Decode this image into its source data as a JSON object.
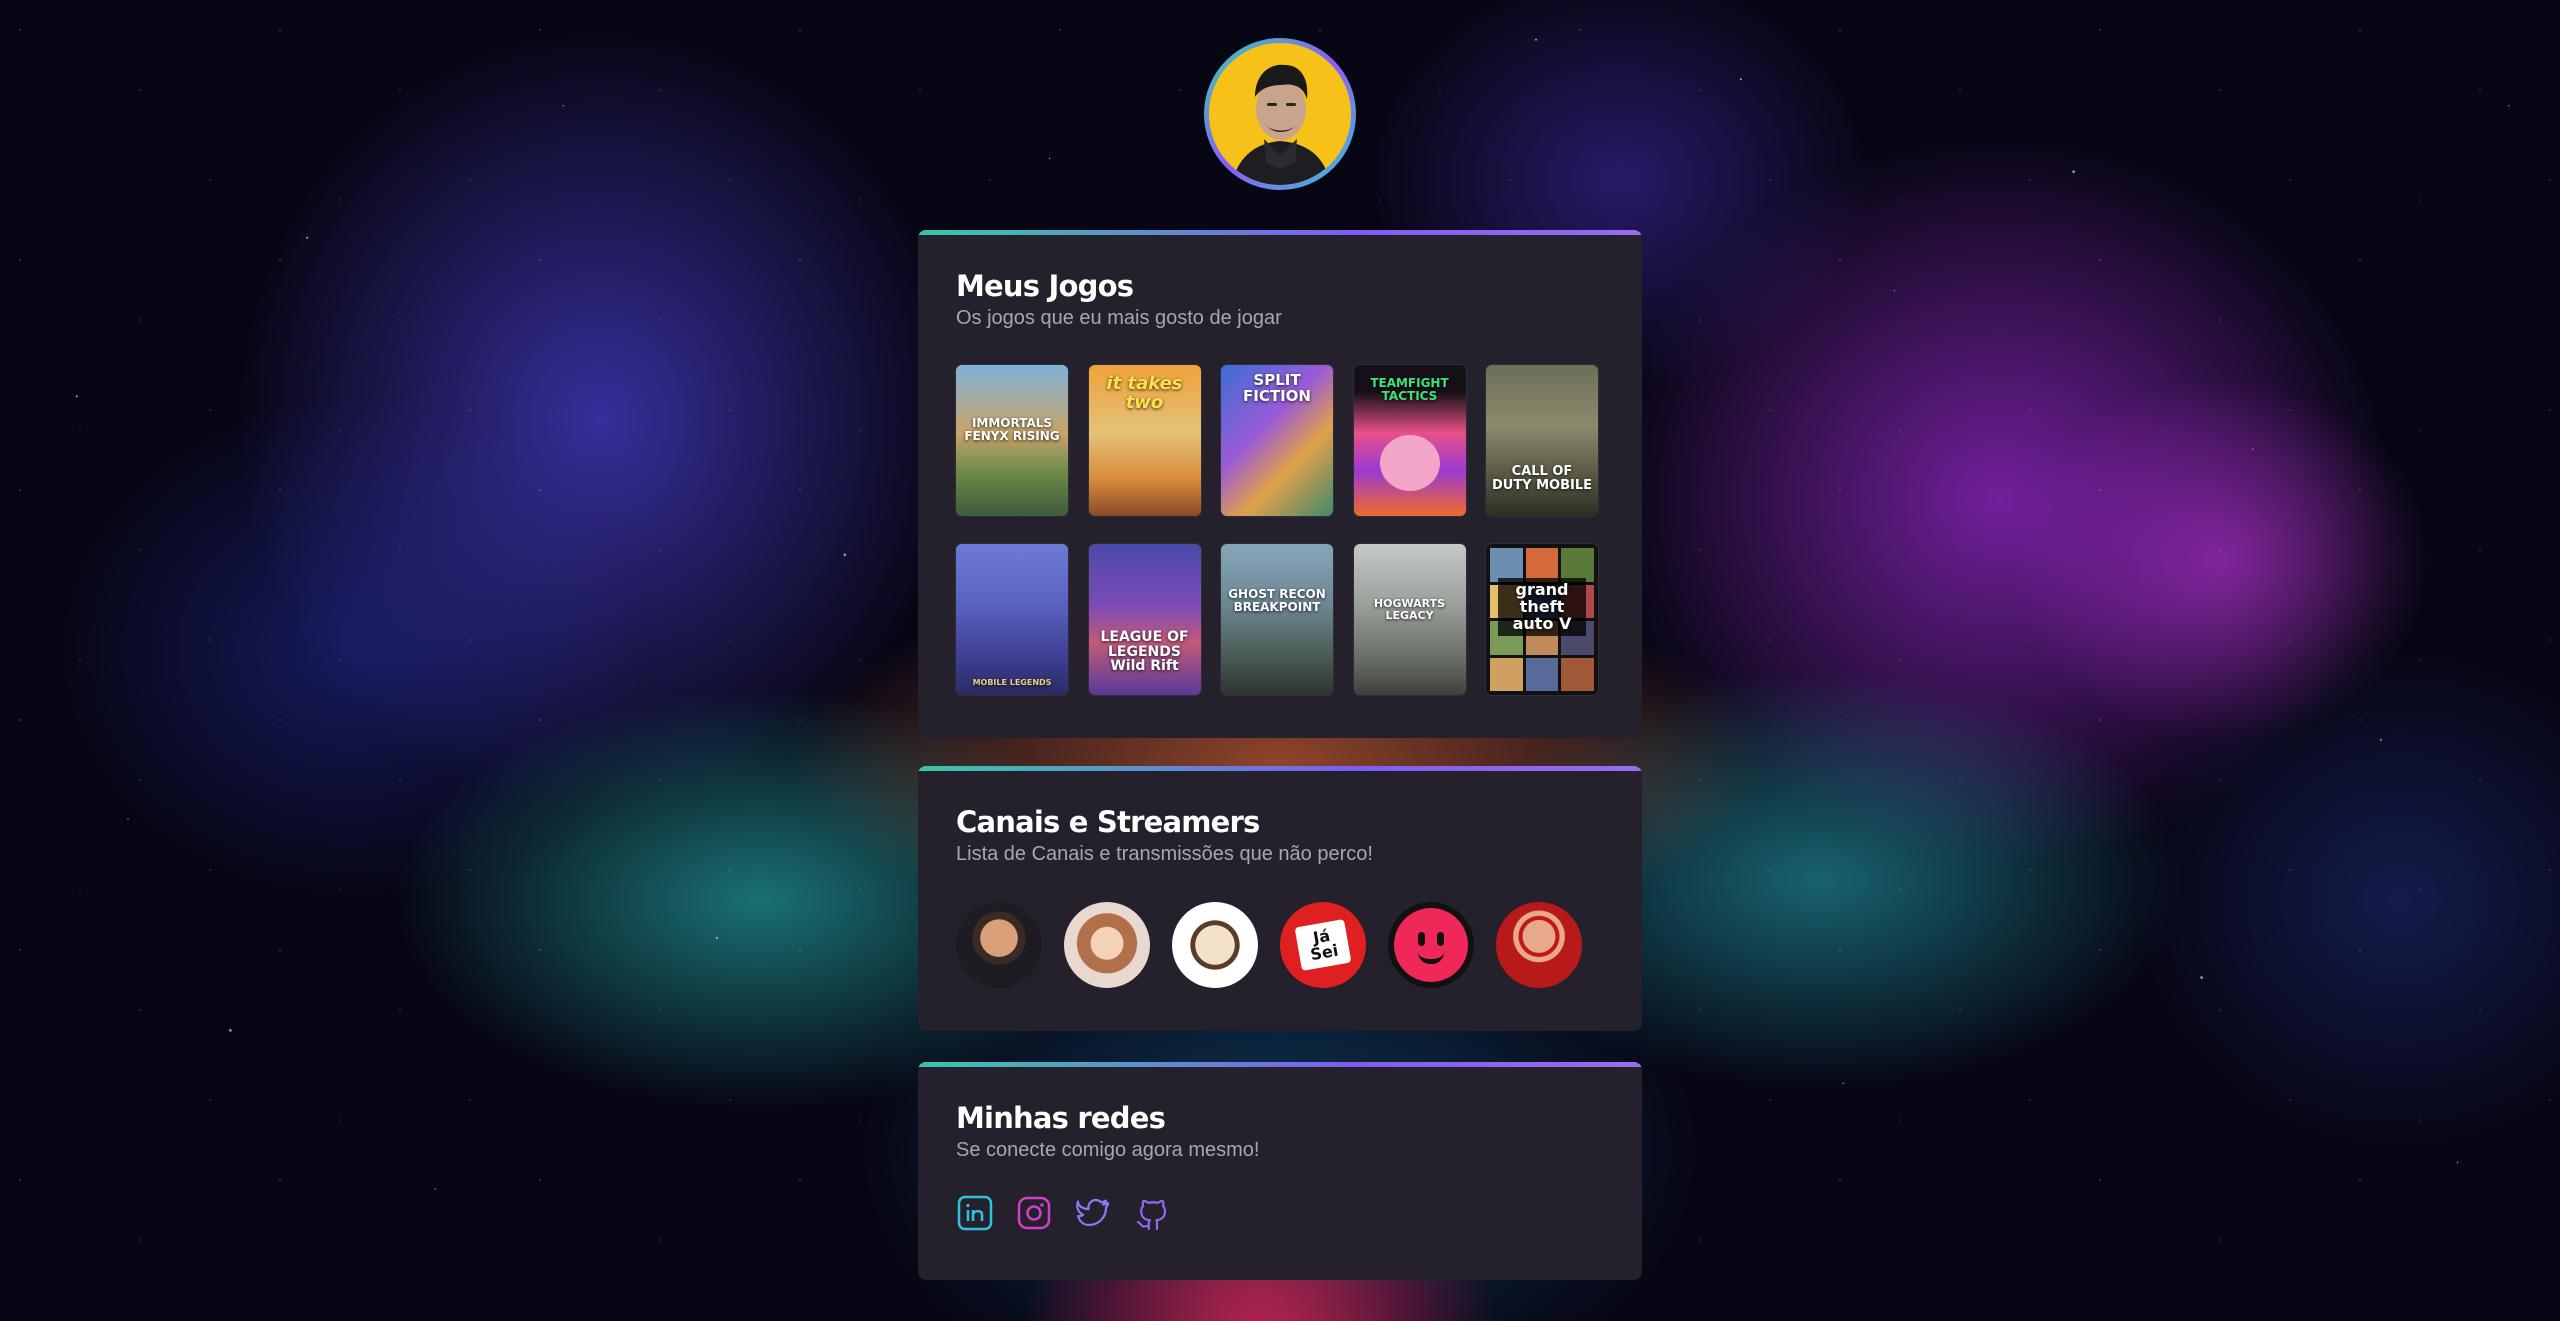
{
  "colors": {
    "card_bg": "#24212d",
    "accent_gradient": [
      "#38c7a8",
      "#7d5df0"
    ],
    "title": "#ffffff",
    "subtitle": "#a8a6b3",
    "linkedin": "#2ec4dd",
    "instagram": "#d43fc9",
    "twitter": "#8a7cf0",
    "github": "#8c6bf0"
  },
  "profile": {
    "avatar_icon": "user-portrait-avatar"
  },
  "games_section": {
    "title": "Meus Jogos",
    "subtitle": "Os jogos que eu mais gosto de jogar",
    "games": [
      {
        "label": "IMMORTALS FENYX RISING"
      },
      {
        "label": "it takes two"
      },
      {
        "label": "SPLIT FICTION"
      },
      {
        "label": "TEAMFIGHT TACTICS"
      },
      {
        "label": "CALL OF DUTY MOBILE"
      },
      {
        "label": "MOBILE LEGENDS"
      },
      {
        "label": "LEAGUE OF LEGENDS Wild Rift"
      },
      {
        "label": "GHOST RECON BREAKPOINT"
      },
      {
        "label": "HOGWARTS LEGACY"
      },
      {
        "label": "grand theft auto V"
      }
    ]
  },
  "streamers_section": {
    "title": "Canais e Streamers",
    "subtitle": "Lista de Canais e transmissões que não perco!",
    "streamers": [
      {
        "icon": "streamer-avatar-1"
      },
      {
        "icon": "streamer-avatar-2"
      },
      {
        "icon": "streamer-avatar-3"
      },
      {
        "icon": "streamer-avatar-4",
        "label": "Já Sei"
      },
      {
        "icon": "streamer-avatar-5"
      },
      {
        "icon": "streamer-avatar-6"
      }
    ]
  },
  "social_section": {
    "title": "Minhas redes",
    "subtitle": "Se conecte comigo agora mesmo!",
    "links": [
      {
        "icon": "linkedin-icon"
      },
      {
        "icon": "instagram-icon"
      },
      {
        "icon": "twitter-icon"
      },
      {
        "icon": "github-icon"
      }
    ]
  }
}
